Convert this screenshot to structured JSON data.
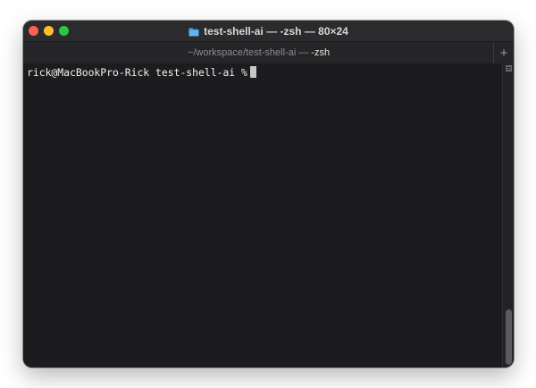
{
  "window": {
    "title": "test-shell-ai — -zsh — 80×24",
    "folder_icon": "folder-icon"
  },
  "tabs": [
    {
      "path": "~/workspace/test-shell-ai",
      "separator": "—",
      "process": "-zsh",
      "active": true
    }
  ],
  "new_tab_label": "+",
  "terminal": {
    "prompt": "rick@MacBookPro-Rick test-shell-ai %",
    "command": ""
  },
  "colors": {
    "close": "#fe5f57",
    "minimize": "#febc2e",
    "zoom": "#28c840",
    "terminal_background": "#1c1c1e",
    "folder": "#4aa8f0"
  }
}
